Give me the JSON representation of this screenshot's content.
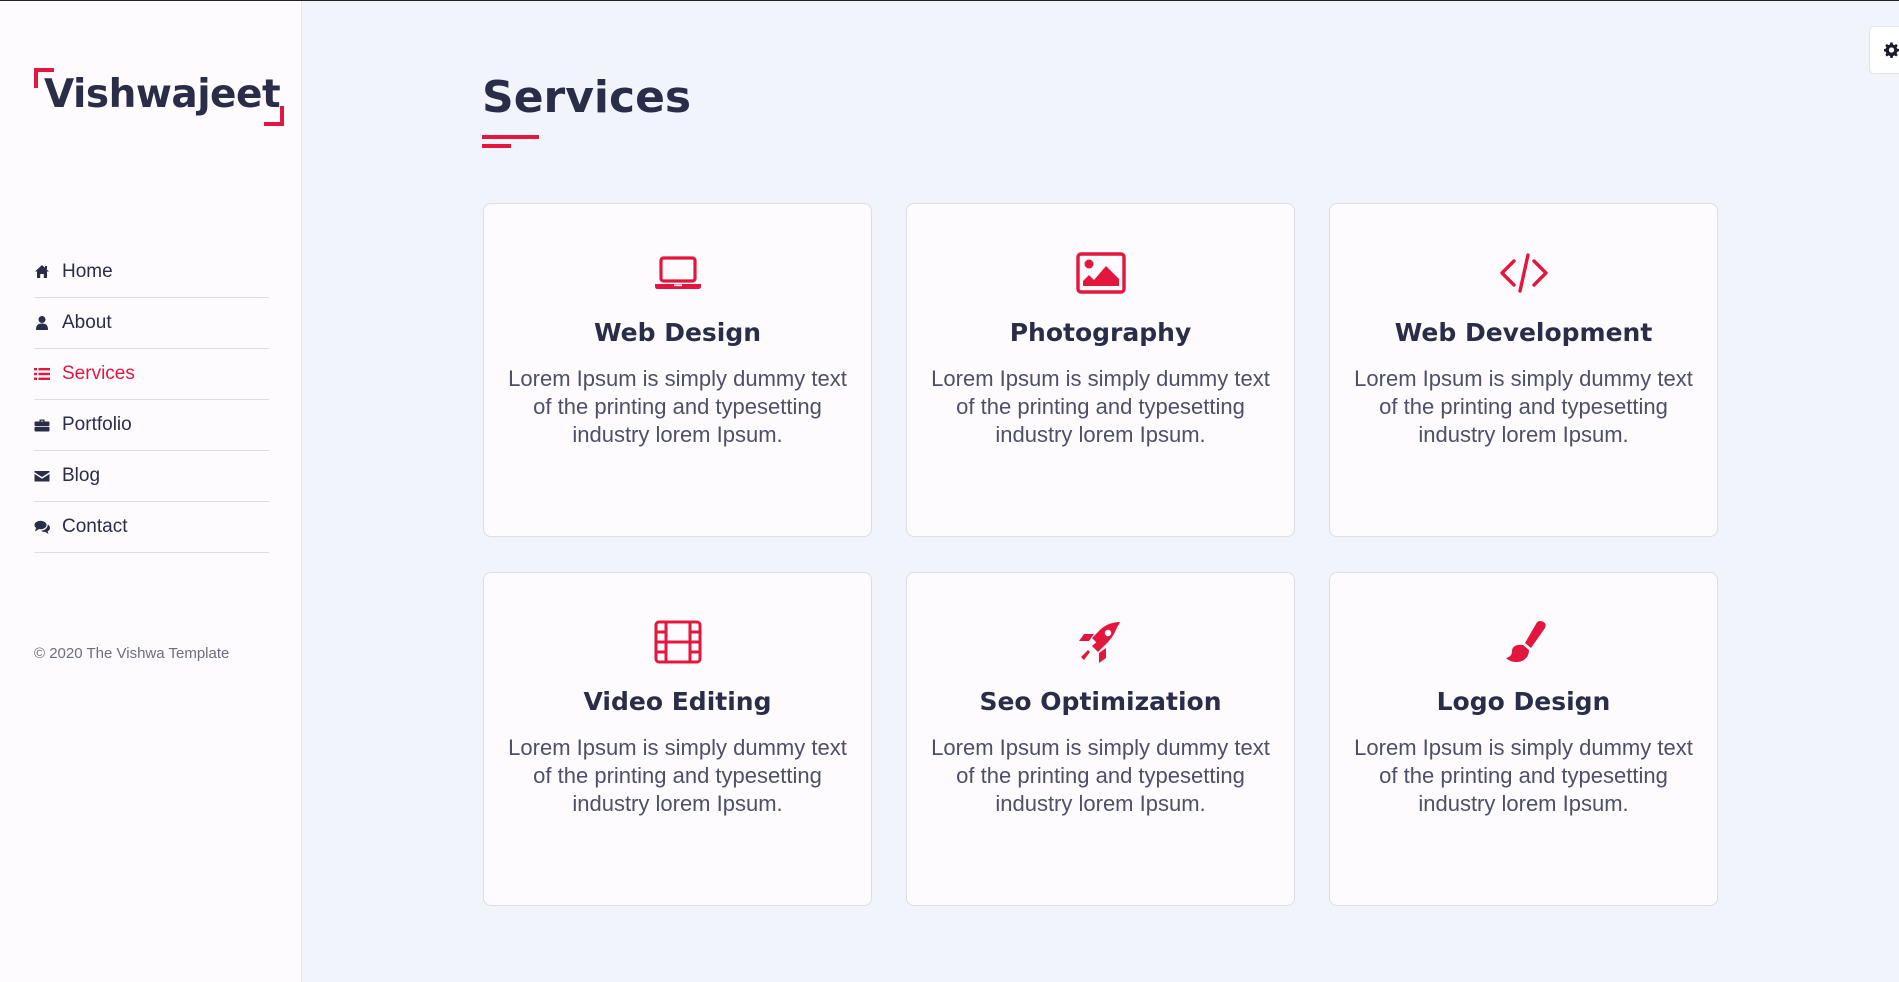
{
  "brand": {
    "logo_text": "Vishwajeet",
    "accent_color": "#e3173e",
    "text_color": "#2a2d48"
  },
  "sidebar": {
    "items": [
      {
        "label": "Home",
        "icon": "home-icon",
        "active": false
      },
      {
        "label": "About",
        "icon": "user-icon",
        "active": false
      },
      {
        "label": "Services",
        "icon": "list-icon",
        "active": true
      },
      {
        "label": "Portfolio",
        "icon": "briefcase-icon",
        "active": false
      },
      {
        "label": "Blog",
        "icon": "envelope-icon",
        "active": false
      },
      {
        "label": "Contact",
        "icon": "comments-icon",
        "active": false
      }
    ],
    "copyright": "© 2020 The Vishwa Template"
  },
  "settings": {
    "icon": "gear-icon"
  },
  "main": {
    "title": "Services",
    "services": [
      {
        "title": "Web Design",
        "icon": "laptop-icon",
        "description": "Lorem Ipsum is simply dummy text of the printing and typesetting industry lorem Ipsum."
      },
      {
        "title": "Photography",
        "icon": "image-icon",
        "description": "Lorem Ipsum is simply dummy text of the printing and typesetting industry lorem Ipsum."
      },
      {
        "title": "Web Development",
        "icon": "code-icon",
        "description": "Lorem Ipsum is simply dummy text of the printing and typesetting industry lorem Ipsum."
      },
      {
        "title": "Video Editing",
        "icon": "film-icon",
        "description": "Lorem Ipsum is simply dummy text of the printing and typesetting industry lorem Ipsum."
      },
      {
        "title": "Seo Optimization",
        "icon": "rocket-icon",
        "description": "Lorem Ipsum is simply dummy text of the printing and typesetting industry lorem Ipsum."
      },
      {
        "title": "Logo Design",
        "icon": "paint-brush-icon",
        "description": "Lorem Ipsum is simply dummy text of the printing and typesetting industry lorem Ipsum."
      }
    ]
  }
}
